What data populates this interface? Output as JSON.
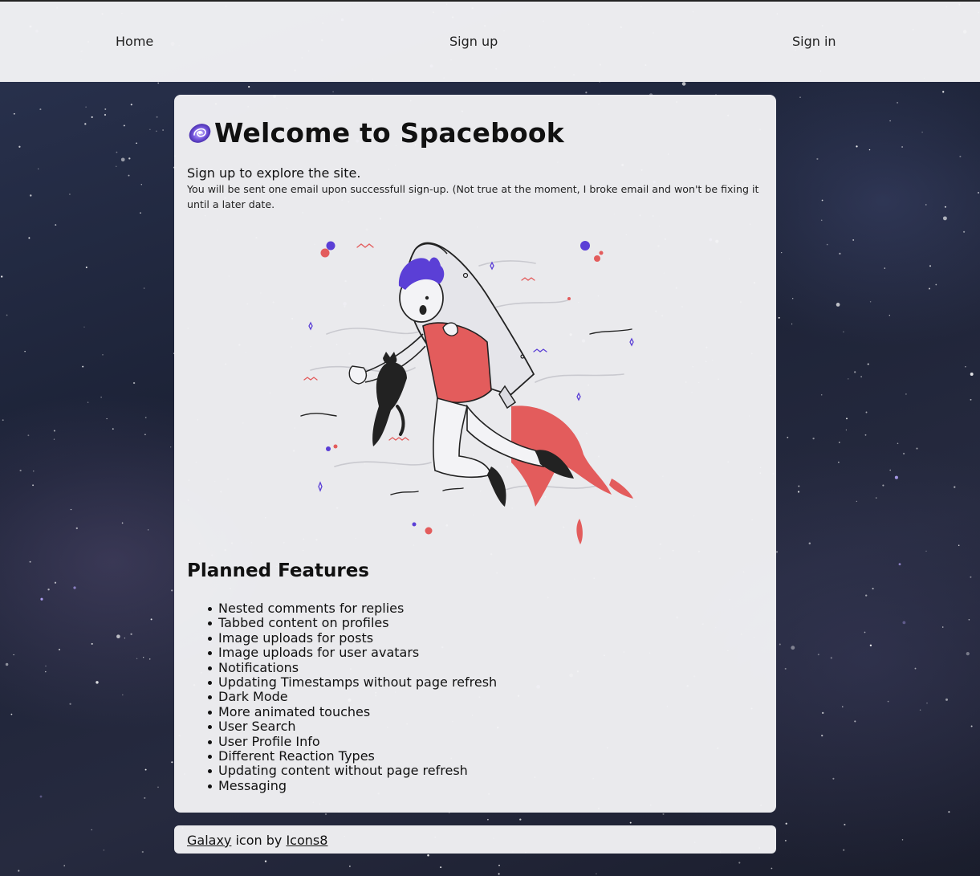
{
  "nav": {
    "home_label": "Home",
    "signup_label": "Sign up",
    "signin_label": "Sign in"
  },
  "main": {
    "title": "Welcome to Spacebook",
    "title_icon": "galaxy-icon",
    "lead": "Sign up to explore the site.",
    "note": "You will be sent one email upon successfull sign-up. (Not true at the moment, I broke email and won't be fixing it until a later date.",
    "illustration": "rocket-astronaut-with-cat-illustration"
  },
  "features": {
    "title": "Planned Features",
    "items": [
      "Nested comments for replies",
      "Tabbed content on profiles",
      "Image uploads for posts",
      "Image uploads for user avatars",
      "Notifications",
      "Updating Timestamps without page refresh",
      "Dark Mode",
      "More animated touches",
      "User Search",
      "User Profile Info",
      "Different Reaction Types",
      "Updating content without page refresh",
      "Messaging"
    ]
  },
  "footer": {
    "galaxy_link": "Galaxy",
    "middle_text": " icon by ",
    "icons8_link": "Icons8"
  },
  "colors": {
    "accent_purple": "#5b3fd6",
    "accent_red": "#e35c5c",
    "card_bg": "#f2f2f5"
  }
}
